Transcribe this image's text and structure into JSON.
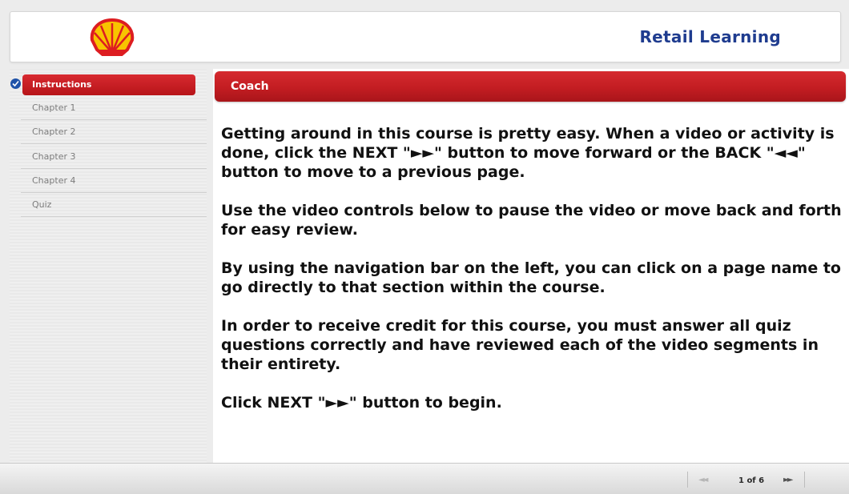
{
  "header": {
    "title": "Retail Learning",
    "logo_icon": "shell-logo-icon"
  },
  "sidebar": {
    "items": [
      {
        "label": "Instructions",
        "active": true
      },
      {
        "label": "Chapter 1"
      },
      {
        "label": "Chapter 2"
      },
      {
        "label": "Chapter 3"
      },
      {
        "label": "Chapter 4"
      },
      {
        "label": "Quiz"
      }
    ]
  },
  "main": {
    "section_title": "Coach",
    "paragraphs": [
      "Getting around in this course is pretty easy. When a video or activity is done, click the NEXT \"►►\" button to move forward or the BACK \"◄◄\" button to move to a previous page.",
      "Use the video controls below to pause the video or move back and forth for easy review.",
      "By using the navigation bar on the left, you can click on a page name to go directly to that section within the course.",
      "In order to receive credit for this course, you must answer all quiz questions correctly and have reviewed each of the video segments in their entirety.",
      "Click NEXT \"►►\" button to begin."
    ]
  },
  "footer": {
    "back_icon": "◄◄",
    "next_icon": "►►",
    "page_indicator": "1 of 6"
  },
  "colors": {
    "accent_red": "#c31d22",
    "brand_blue": "#1f3c8f",
    "shell_yellow": "#f8c400"
  }
}
